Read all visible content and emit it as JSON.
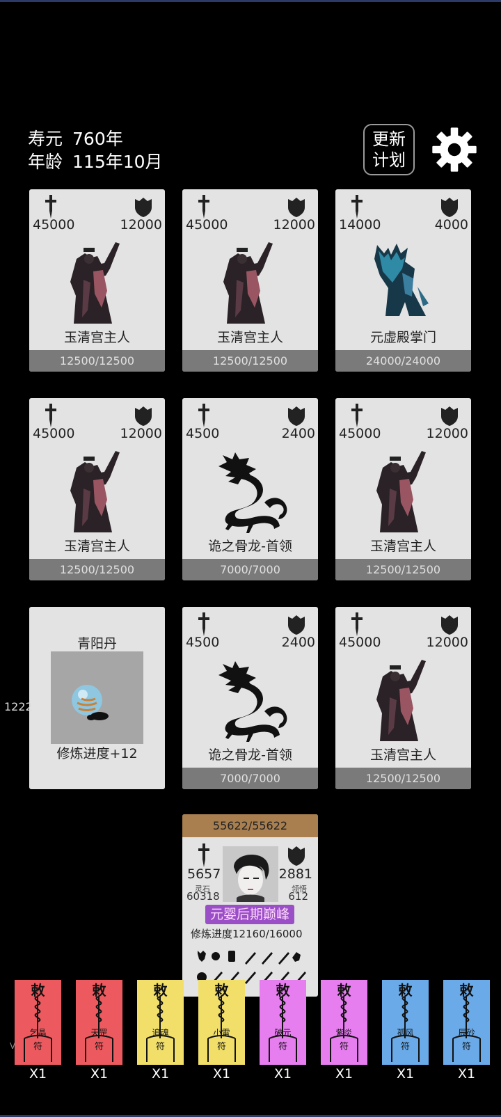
{
  "status": {
    "lifespan_label": "寿元",
    "lifespan_value": "760年",
    "age_label": "年龄",
    "age_value": "115年10月"
  },
  "buttons": {
    "update_plan_line1": "更新",
    "update_plan_line2": "计划",
    "settings_icon": "gear-icon"
  },
  "cards": [
    {
      "atk": "45000",
      "def": "12000",
      "name": "玉清宫主人",
      "hp": "12500/12500",
      "portrait": "sword-master"
    },
    {
      "atk": "45000",
      "def": "12000",
      "name": "玉清宫主人",
      "hp": "12500/12500",
      "portrait": "sword-master"
    },
    {
      "atk": "14000",
      "def": "4000",
      "name": "元虚殿掌门",
      "hp": "24000/24000",
      "portrait": "blue-sect-master"
    },
    {
      "atk": "45000",
      "def": "12000",
      "name": "玉清宫主人",
      "hp": "12500/12500",
      "portrait": "sword-master"
    },
    {
      "atk": "4500",
      "def": "2400",
      "name": "诡之骨龙-首领",
      "hp": "7000/7000",
      "portrait": "bone-dragon"
    },
    {
      "atk": "45000",
      "def": "12000",
      "name": "玉清宫主人",
      "hp": "12500/12500",
      "portrait": "sword-master"
    },
    {
      "atk": "4500",
      "def": "2400",
      "name": "诡之骨龙-首领",
      "hp": "7000/7000",
      "portrait": "bone-dragon"
    },
    {
      "atk": "45000",
      "def": "12000",
      "name": "玉清宫主人",
      "hp": "12500/12500",
      "portrait": "sword-master"
    }
  ],
  "item_card": {
    "name": "青阳丹",
    "effect": "修炼进度+12"
  },
  "side_number": "1222",
  "player": {
    "hp": "55622/55622",
    "atk": "5657",
    "def": "2881",
    "spirit_stone_label": "灵石",
    "spirit_stone": "60318",
    "insight_label": "领悟",
    "insight": "612",
    "realm": "元婴后期巅峰",
    "progress_label": "修炼进度",
    "progress_value": "12160/16000"
  },
  "talismans": [
    {
      "name": "乞晶",
      "count": "X1",
      "color": "#ec5a5f"
    },
    {
      "name": "天罡",
      "count": "X1",
      "color": "#ec5a5f"
    },
    {
      "name": "追魂",
      "count": "X1",
      "color": "#f1df6a"
    },
    {
      "name": "小雷",
      "count": "X1",
      "color": "#f1df6a"
    },
    {
      "name": "破元",
      "count": "X1",
      "color": "#e77ef0"
    },
    {
      "name": "紫炎",
      "count": "X1",
      "color": "#e77ef0"
    },
    {
      "name": "孤风",
      "count": "X1",
      "color": "#6aaae8"
    },
    {
      "name": "辰砂",
      "count": "X1",
      "color": "#6aaae8"
    }
  ],
  "talisman_top_glyph": "敕",
  "talisman_bottom_glyph": "符",
  "corner_mark": "V"
}
